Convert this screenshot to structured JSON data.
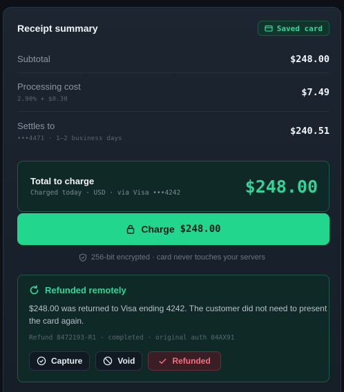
{
  "header": {
    "title": "Receipt summary",
    "badge": "Saved card"
  },
  "rows": [
    {
      "label": "Subtotal",
      "sub": "",
      "value": "$248.00"
    },
    {
      "label": "Processing cost",
      "sub": "2.90% + $0.30",
      "value": "$7.49"
    },
    {
      "label": "Settles to",
      "sub": "•••4471 · 1–2 business days",
      "value": "$240.51"
    }
  ],
  "total": {
    "label": "Total to charge",
    "sub": "Charged today · USD · via Visa •••4242",
    "amount": "$248.00"
  },
  "charge_button": {
    "label": "Charge",
    "amount": "$248.00"
  },
  "secure_note": "256-bit encrypted · card never touches your servers",
  "refund": {
    "title": "Refunded remotely",
    "body": "$248.00 was returned to Visa ending 4242. The customer did not need to present the card again.",
    "meta": "Refund 8472193-R1 · completed · original auth 04AX91",
    "actions": {
      "capture": "Capture",
      "void": "Void",
      "refunded": "Refunded"
    }
  },
  "colors": {
    "accent": "#22d68e",
    "accent_text": "#34d399",
    "danger": "#ff6b7a"
  },
  "icons": [
    "card-icon",
    "lock-icon",
    "shield-icon",
    "refresh-icon",
    "check-circle-icon",
    "void-icon",
    "checkmark-icon"
  ]
}
